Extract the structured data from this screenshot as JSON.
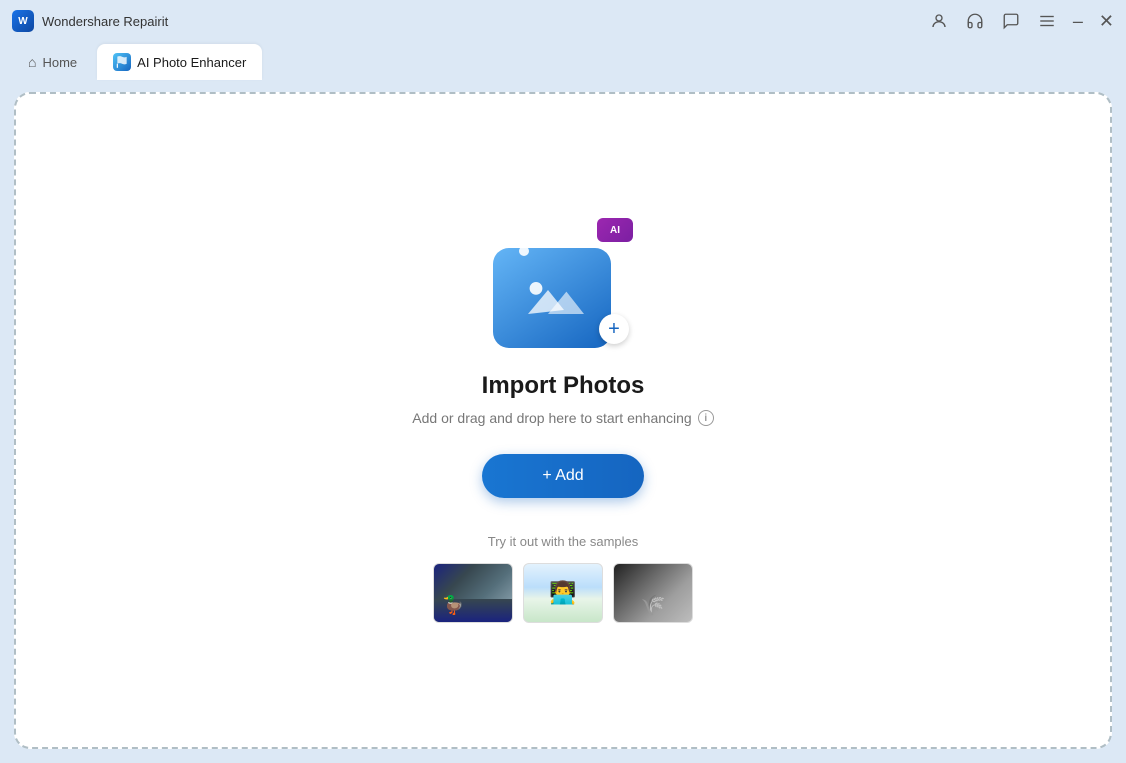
{
  "titleBar": {
    "appName": "Wondershare Repairit",
    "minimizeLabel": "minimize",
    "closeLabel": "close"
  },
  "tabs": {
    "homeLabel": "Home",
    "activeTabLabel": "AI Photo Enhancer"
  },
  "dropZone": {
    "aiLabel": "AI",
    "importTitle": "Import Photos",
    "importSubtitle": "Add or drag and drop here to start enhancing",
    "addButtonLabel": "+ Add",
    "samplesLabel": "Try it out with the samples"
  },
  "samples": [
    {
      "id": "sample-1",
      "alt": "ducks in water"
    },
    {
      "id": "sample-2",
      "alt": "man at laptop"
    },
    {
      "id": "sample-3",
      "alt": "black and white field"
    }
  ]
}
